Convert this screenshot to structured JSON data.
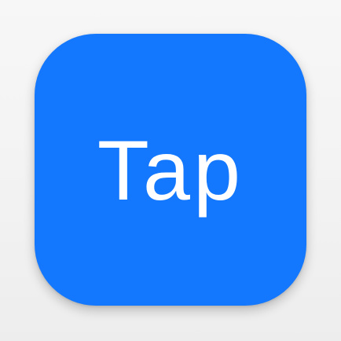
{
  "app_icon": {
    "label": "Tap",
    "accent_color": "#1478ff",
    "text_color": "#ffffff"
  }
}
